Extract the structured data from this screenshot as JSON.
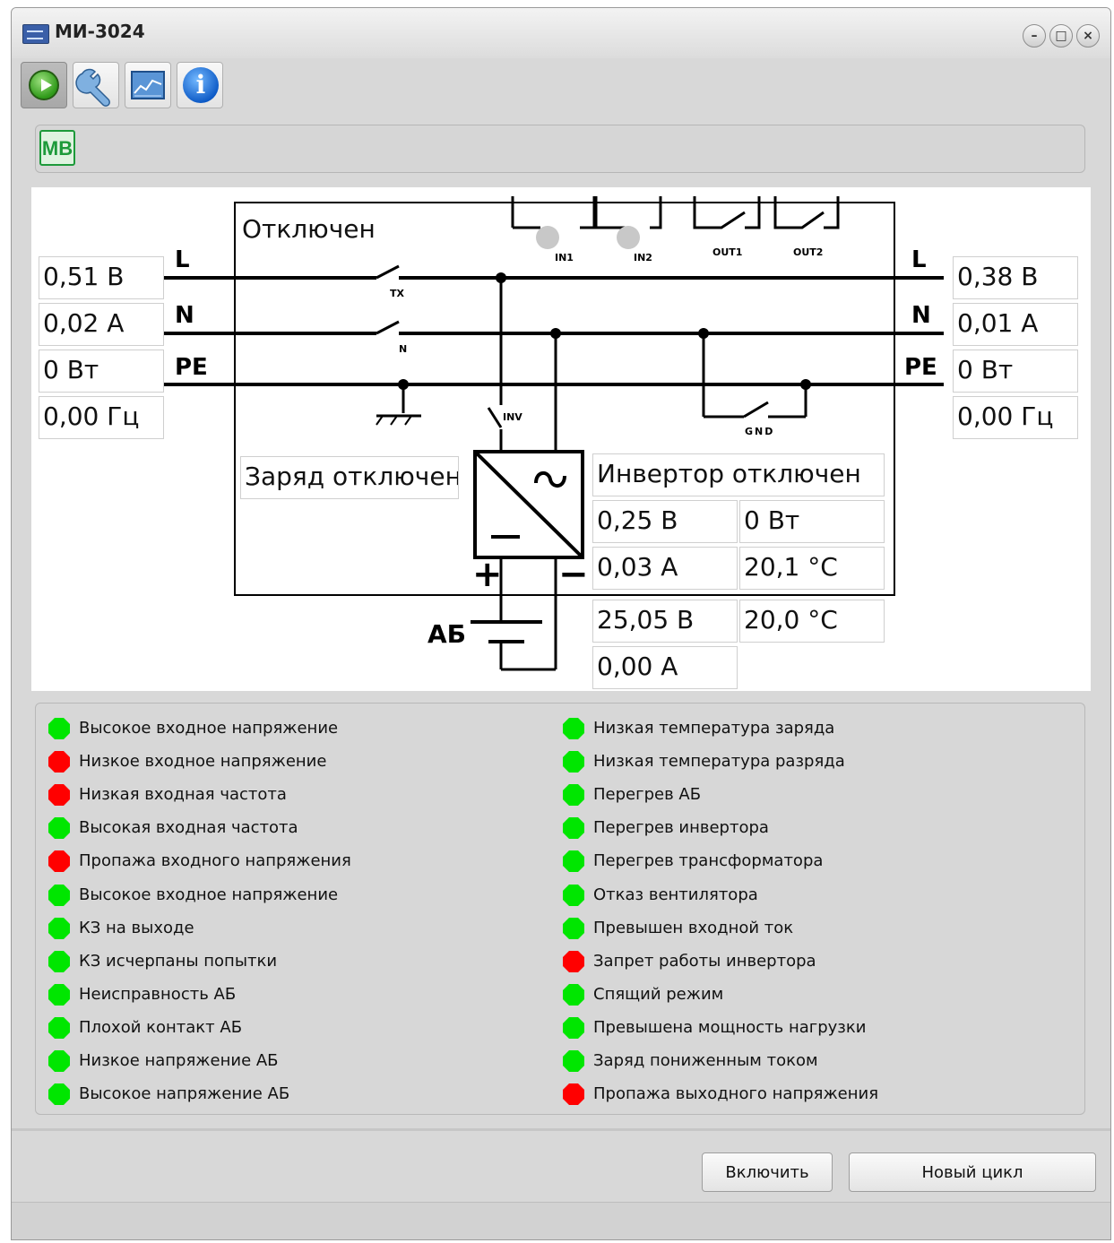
{
  "window": {
    "title": "МИ-3024"
  },
  "toolbar": {
    "buttons": [
      {
        "icon": "play-icon"
      },
      {
        "icon": "wrench-icon"
      },
      {
        "icon": "chart-icon"
      },
      {
        "icon": "info-icon",
        "glyph": "i"
      }
    ]
  },
  "mode_badge": "MB",
  "diagram": {
    "status": "Отключен",
    "charge_status": "Заряд отключен",
    "inverter_status": "Инвертор отключен",
    "input": {
      "voltage": "0,51 В",
      "current": "0,02 А",
      "power": "0 Вт",
      "frequency": "0,00 Гц"
    },
    "output": {
      "voltage": "0,38 В",
      "current": "0,01 А",
      "power": "0 Вт",
      "frequency": "0,00 Гц"
    },
    "inverter": {
      "voltage": "0,25 В",
      "power": "0 Вт",
      "current": "0,03 А",
      "temperature": "20,1 °C"
    },
    "battery": {
      "voltage": "25,05 В",
      "temperature": "20,0 °C",
      "current": "0,00 А"
    },
    "line_labels": {
      "L": "L",
      "N": "N",
      "PE": "PE"
    },
    "switch_labels": {
      "tx": "TX",
      "n": "N",
      "inv": "INV",
      "gnd": "GND"
    },
    "relay_labels": [
      "IN1",
      "IN2",
      "OUT1",
      "OUT2"
    ],
    "battery_label": "АБ",
    "plus": "+",
    "minus": "−",
    "colors": {
      "ok": "#00e600",
      "alarm": "#ff0000"
    }
  },
  "alarms_left": [
    {
      "label": "Высокое входное напряжение",
      "state": "ok"
    },
    {
      "label": "Низкое входное напряжение",
      "state": "alarm"
    },
    {
      "label": "Низкая входная частота",
      "state": "alarm"
    },
    {
      "label": "Высокая входная частота",
      "state": "ok"
    },
    {
      "label": "Пропажа входного напряжения",
      "state": "alarm"
    },
    {
      "label": "Высокое входное напряжение",
      "state": "ok"
    },
    {
      "label": "КЗ на выходе",
      "state": "ok"
    },
    {
      "label": "КЗ исчерпаны попытки",
      "state": "ok"
    },
    {
      "label": "Неисправность АБ",
      "state": "ok"
    },
    {
      "label": "Плохой контакт АБ",
      "state": "ok"
    },
    {
      "label": "Низкое напряжение АБ",
      "state": "ok"
    },
    {
      "label": "Высокое напряжение АБ",
      "state": "ok"
    }
  ],
  "alarms_right": [
    {
      "label": "Низкая температура заряда",
      "state": "ok"
    },
    {
      "label": "Низкая температура разряда",
      "state": "ok"
    },
    {
      "label": "Перегрев АБ",
      "state": "ok"
    },
    {
      "label": "Перегрев инвертора",
      "state": "ok"
    },
    {
      "label": "Перегрев трансформатора",
      "state": "ok"
    },
    {
      "label": "Отказ вентилятора",
      "state": "ok"
    },
    {
      "label": "Превышен входной ток",
      "state": "ok"
    },
    {
      "label": "Запрет работы инвертора",
      "state": "alarm"
    },
    {
      "label": "Спящий режим",
      "state": "ok"
    },
    {
      "label": "Превышена мощность нагрузки",
      "state": "ok"
    },
    {
      "label": "Заряд пониженным током",
      "state": "ok"
    },
    {
      "label": "Пропажа выходного напряжения",
      "state": "alarm"
    }
  ],
  "buttons": {
    "enable": "Включить",
    "new_cycle": "Новый цикл"
  }
}
